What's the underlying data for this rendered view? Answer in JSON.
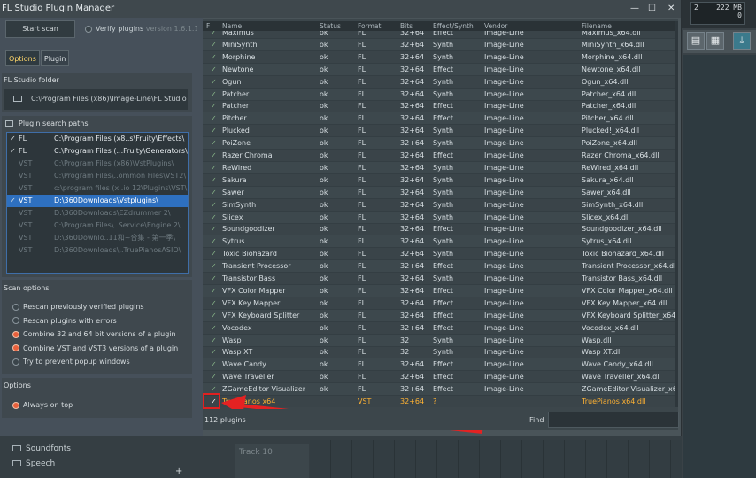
{
  "window": {
    "title": "FL Studio Plugin Manager",
    "min": "—",
    "max": "☐",
    "close": "✕"
  },
  "daw": {
    "mem_top": "2",
    "mem_size": "222 MB",
    "mem_bottom": "0",
    "browser": [
      "Soundfonts",
      "Speech"
    ],
    "track": "Track 10",
    "add": "+"
  },
  "left": {
    "start_scan": "Start scan",
    "verify_label": "Verify plugins",
    "version": "version 1.6.1.165",
    "tabs": [
      "Options",
      "Plugin"
    ],
    "folder_title": "FL Studio folder",
    "folder_path": "C:\\Program Files (x86)\\Image-Line\\FL Studio 12\\",
    "search_title": "Plugin search paths",
    "paths": [
      {
        "check": "✓",
        "type": "FL",
        "path": "C:\\Program Files (x8..s\\Fruity\\Effects\\",
        "state": "en"
      },
      {
        "check": "✓",
        "type": "FL",
        "path": "C:\\Program Files (...Fruity\\Generators\\",
        "state": "en"
      },
      {
        "check": "",
        "type": "VST",
        "path": "C:\\Program Files (x86)\\VstPlugins\\",
        "state": "dis"
      },
      {
        "check": "",
        "type": "VST",
        "path": "C:\\Program Files\\..ommon Files\\VST2\\",
        "state": "dis"
      },
      {
        "check": "",
        "type": "VST",
        "path": "c:\\program files (x..io 12\\Plugins\\VST\\",
        "state": "dis"
      },
      {
        "check": "✓",
        "type": "VST",
        "path": "D:\\360Downloads\\Vstplugins\\",
        "state": "sel"
      },
      {
        "check": "",
        "type": "VST",
        "path": "D:\\360Downloads\\EZdrummer 2\\",
        "state": "dis"
      },
      {
        "check": "",
        "type": "VST",
        "path": "C:\\Program Files\\..Service\\Engine 2\\",
        "state": "dis"
      },
      {
        "check": "",
        "type": "VST",
        "path": "D:\\360Downlo..11和~合集 - 第一季\\",
        "state": "dis"
      },
      {
        "check": "",
        "type": "VST",
        "path": "D:\\360Downloads\\..TruePianosASIO\\",
        "state": "dis"
      }
    ],
    "scan_title": "Scan options",
    "scan_options": [
      {
        "label": "Rescan previously verified plugins",
        "on": false
      },
      {
        "label": "Rescan plugins with errors",
        "on": false
      },
      {
        "label": "Combine 32 and 64 bit versions of a plugin",
        "on": true
      },
      {
        "label": "Combine VST and VST3 versions of a plugin",
        "on": true
      },
      {
        "label": "Try to prevent popup windows",
        "on": false
      }
    ],
    "options_title": "Options",
    "always_on_top": "Always on top"
  },
  "table": {
    "headers": {
      "f": "F",
      "name": "Name",
      "status": "Status",
      "format": "Format",
      "bits": "Bits",
      "effect": "Effect/Synth",
      "vendor": "Vendor",
      "filename": "Filename"
    },
    "rows": [
      [
        "✓",
        "Maximus",
        "ok",
        "FL",
        "32+64",
        "Effect",
        "Image-Line",
        "Maximus_x64.dll"
      ],
      [
        "✓",
        "MiniSynth",
        "ok",
        "FL",
        "32+64",
        "Synth",
        "Image-Line",
        "MiniSynth_x64.dll"
      ],
      [
        "✓",
        "Morphine",
        "ok",
        "FL",
        "32+64",
        "Synth",
        "Image-Line",
        "Morphine_x64.dll"
      ],
      [
        "✓",
        "Newtone",
        "ok",
        "FL",
        "32+64",
        "Effect",
        "Image-Line",
        "Newtone_x64.dll"
      ],
      [
        "✓",
        "Ogun",
        "ok",
        "FL",
        "32+64",
        "Synth",
        "Image-Line",
        "Ogun_x64.dll"
      ],
      [
        "✓",
        "Patcher",
        "ok",
        "FL",
        "32+64",
        "Synth",
        "Image-Line",
        "Patcher_x64.dll"
      ],
      [
        "✓",
        "Patcher",
        "ok",
        "FL",
        "32+64",
        "Effect",
        "Image-Line",
        "Patcher_x64.dll"
      ],
      [
        "✓",
        "Pitcher",
        "ok",
        "FL",
        "32+64",
        "Effect",
        "Image-Line",
        "Pitcher_x64.dll"
      ],
      [
        "✓",
        "Plucked!",
        "ok",
        "FL",
        "32+64",
        "Synth",
        "Image-Line",
        "Plucked!_x64.dll"
      ],
      [
        "✓",
        "PoiZone",
        "ok",
        "FL",
        "32+64",
        "Synth",
        "Image-Line",
        "PoiZone_x64.dll"
      ],
      [
        "✓",
        "Razer Chroma",
        "ok",
        "FL",
        "32+64",
        "Effect",
        "Image-Line",
        "Razer Chroma_x64.dll"
      ],
      [
        "✓",
        "ReWired",
        "ok",
        "FL",
        "32+64",
        "Synth",
        "Image-Line",
        "ReWired_x64.dll"
      ],
      [
        "✓",
        "Sakura",
        "ok",
        "FL",
        "32+64",
        "Synth",
        "Image-Line",
        "Sakura_x64.dll"
      ],
      [
        "✓",
        "Sawer",
        "ok",
        "FL",
        "32+64",
        "Synth",
        "Image-Line",
        "Sawer_x64.dll"
      ],
      [
        "✓",
        "SimSynth",
        "ok",
        "FL",
        "32+64",
        "Synth",
        "Image-Line",
        "SimSynth_x64.dll"
      ],
      [
        "✓",
        "Slicex",
        "ok",
        "FL",
        "32+64",
        "Synth",
        "Image-Line",
        "Slicex_x64.dll"
      ],
      [
        "✓",
        "Soundgoodizer",
        "ok",
        "FL",
        "32+64",
        "Effect",
        "Image-Line",
        "Soundgoodizer_x64.dll"
      ],
      [
        "✓",
        "Sytrus",
        "ok",
        "FL",
        "32+64",
        "Synth",
        "Image-Line",
        "Sytrus_x64.dll"
      ],
      [
        "✓",
        "Toxic Biohazard",
        "ok",
        "FL",
        "32+64",
        "Synth",
        "Image-Line",
        "Toxic Biohazard_x64.dll"
      ],
      [
        "✓",
        "Transient Processor",
        "ok",
        "FL",
        "32+64",
        "Effect",
        "Image-Line",
        "Transient Processor_x64.dll"
      ],
      [
        "✓",
        "Transistor Bass",
        "ok",
        "FL",
        "32+64",
        "Synth",
        "Image-Line",
        "Transistor Bass_x64.dll"
      ],
      [
        "✓",
        "VFX Color Mapper",
        "ok",
        "FL",
        "32+64",
        "Effect",
        "Image-Line",
        "VFX Color Mapper_x64.dll"
      ],
      [
        "✓",
        "VFX Key Mapper",
        "ok",
        "FL",
        "32+64",
        "Effect",
        "Image-Line",
        "VFX Key Mapper_x64.dll"
      ],
      [
        "✓",
        "VFX Keyboard Splitter",
        "ok",
        "FL",
        "32+64",
        "Effect",
        "Image-Line",
        "VFX Keyboard Splitter_x64.dll"
      ],
      [
        "✓",
        "Vocodex",
        "ok",
        "FL",
        "32+64",
        "Effect",
        "Image-Line",
        "Vocodex_x64.dll"
      ],
      [
        "✓",
        "Wasp",
        "ok",
        "FL",
        "32",
        "Synth",
        "Image-Line",
        "Wasp.dll"
      ],
      [
        "✓",
        "Wasp XT",
        "ok",
        "FL",
        "32",
        "Synth",
        "Image-Line",
        "Wasp XT.dll"
      ],
      [
        "✓",
        "Wave Candy",
        "ok",
        "FL",
        "32+64",
        "Effect",
        "Image-Line",
        "Wave Candy_x64.dll"
      ],
      [
        "✓",
        "Wave Traveller",
        "ok",
        "FL",
        "32+64",
        "Effect",
        "Image-Line",
        "Wave Traveller_x64.dll"
      ],
      [
        "✓",
        "ZGameEditor Visualizer",
        "ok",
        "FL",
        "32+64",
        "Effect",
        "Image-Line",
        "ZGameEditor Visualizer_x64"
      ]
    ],
    "new_row": [
      "✓",
      "TruePianos x64",
      "",
      "VST",
      "32+64",
      "?",
      "",
      "TruePianos x64.dll"
    ]
  },
  "footer": {
    "count": "112 plugins",
    "find": "Find"
  }
}
